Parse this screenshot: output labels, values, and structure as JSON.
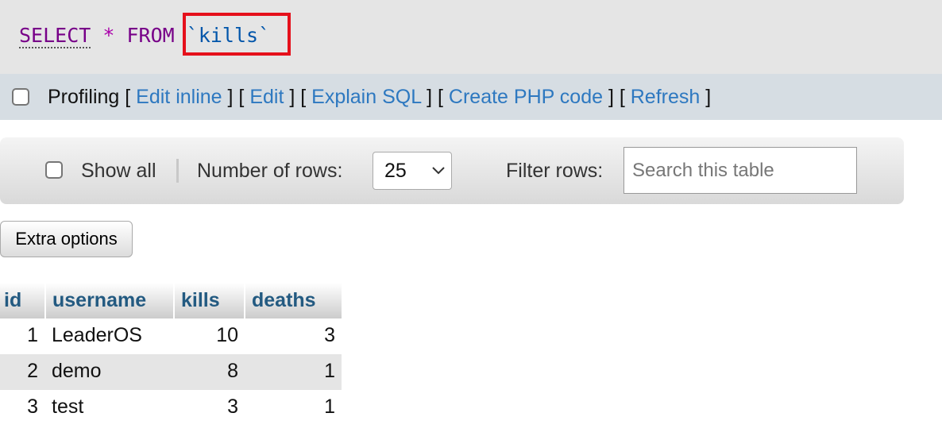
{
  "sql": {
    "select": "SELECT",
    "star": "*",
    "from": "FROM",
    "table": "`kills`"
  },
  "toolbar": {
    "profiling_label": "Profiling",
    "links": [
      "Edit inline",
      "Edit",
      "Explain SQL",
      "Create PHP code",
      "Refresh"
    ]
  },
  "nav": {
    "show_all_label": "Show all",
    "rows_label": "Number of rows:",
    "rows_value": "25",
    "filter_label": "Filter rows:",
    "search_placeholder": "Search this table"
  },
  "extra_options_label": "Extra options",
  "table": {
    "columns": [
      "id",
      "username",
      "kills",
      "deaths"
    ],
    "rows": [
      {
        "id": "1",
        "username": "LeaderOS",
        "kills": "10",
        "deaths": "3"
      },
      {
        "id": "2",
        "username": "demo",
        "kills": "8",
        "deaths": "1"
      },
      {
        "id": "3",
        "username": "test",
        "kills": "3",
        "deaths": "1"
      }
    ]
  },
  "colors": {
    "highlight": "#e5101b",
    "link": "#2d78c0",
    "header_text": "#235a81",
    "keyword": "#770088"
  }
}
